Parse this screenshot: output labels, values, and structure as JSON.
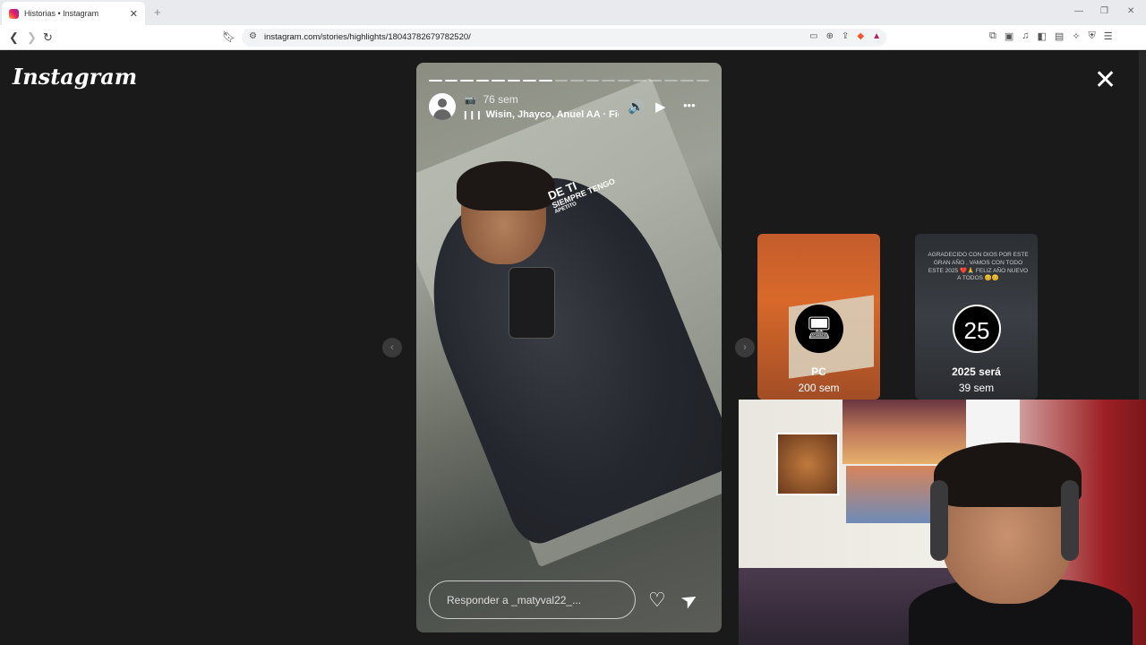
{
  "browser": {
    "tab_title": "Historias • Instagram",
    "tab_close": "✕",
    "new_tab": "+",
    "url": "instagram.com/stories/highlights/18043782679782520/",
    "window_controls": [
      "—",
      "❐",
      "✕"
    ]
  },
  "page": {
    "logo": "Instagram",
    "close": "✕"
  },
  "story": {
    "progress_total": 18,
    "progress_done": 8,
    "time": "76 sem",
    "music": "Wisin, Jhayco, Anuel AA · Fiel (I",
    "sticker_line1": "DE TI",
    "sticker_line2": "SIEMPRE TENGO",
    "sticker_line3": "APETITO",
    "reply_placeholder": "Responder a _matyval22_...",
    "volume_icon": "🔊",
    "play_icon": "▶",
    "more_icon": "•••",
    "heart_icon": "♡",
    "send_icon": "➤"
  },
  "nav": {
    "prev": "‹",
    "next": "›"
  },
  "highlights": [
    {
      "name": "PC",
      "weeks": "200 sem",
      "icon": "🖥"
    },
    {
      "name": "2025 será",
      "weeks": "39 sem",
      "icon": "25",
      "caption": "AGRADECIDO CON DIOS POR ESTE GRAN AÑO , VAMOS CON TODO ESTE 2025 ❤️🙏 FELIZ AÑO NUEVO A TODOS 😊😊"
    }
  ]
}
